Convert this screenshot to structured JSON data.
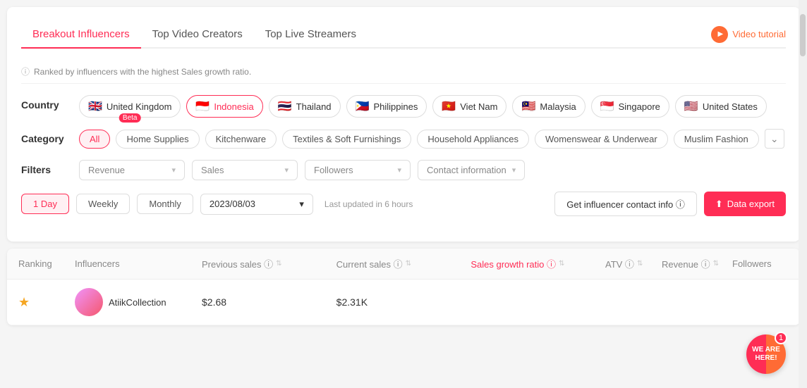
{
  "tabs": [
    {
      "id": "breakout",
      "label": "Breakout Influencers",
      "active": true
    },
    {
      "id": "video",
      "label": "Top Video Creators",
      "active": false
    },
    {
      "id": "live",
      "label": "Top Live Streamers",
      "active": false
    }
  ],
  "video_tutorial": {
    "label": "Video tutorial"
  },
  "info_bar": {
    "text": "Ranked by influencers with the highest Sales growth ratio."
  },
  "country": {
    "label": "Country",
    "options": [
      {
        "id": "uk",
        "flag": "🇬🇧",
        "label": "United Kingdom",
        "selected": false,
        "beta": true
      },
      {
        "id": "indonesia",
        "flag": "🇮🇩",
        "label": "Indonesia",
        "selected": true
      },
      {
        "id": "thailand",
        "flag": "🇹🇭",
        "label": "Thailand",
        "selected": false
      },
      {
        "id": "philippines",
        "flag": "🇵🇭",
        "label": "Philippines",
        "selected": false
      },
      {
        "id": "vietnam",
        "flag": "🇻🇳",
        "label": "Viet Nam",
        "selected": false
      },
      {
        "id": "malaysia",
        "flag": "🇲🇾",
        "label": "Malaysia",
        "selected": false
      },
      {
        "id": "singapore",
        "flag": "🇸🇬",
        "label": "Singapore",
        "selected": false
      },
      {
        "id": "us",
        "flag": "🇺🇸",
        "label": "United States",
        "selected": false
      }
    ]
  },
  "category": {
    "label": "Category",
    "options": [
      {
        "id": "all",
        "label": "All",
        "active": true
      },
      {
        "id": "home",
        "label": "Home Supplies",
        "active": false
      },
      {
        "id": "kitchen",
        "label": "Kitchenware",
        "active": false
      },
      {
        "id": "textiles",
        "label": "Textiles & Soft Furnishings",
        "active": false
      },
      {
        "id": "household",
        "label": "Household Appliances",
        "active": false
      },
      {
        "id": "womens",
        "label": "Womenswear & Underwear",
        "active": false
      },
      {
        "id": "muslim",
        "label": "Muslim Fashion",
        "active": false
      }
    ]
  },
  "filters": {
    "label": "Filters",
    "selects": [
      {
        "id": "revenue",
        "placeholder": "Revenue"
      },
      {
        "id": "sales",
        "placeholder": "Sales"
      },
      {
        "id": "followers",
        "placeholder": "Followers"
      },
      {
        "id": "contact",
        "placeholder": "Contact information"
      }
    ]
  },
  "time": {
    "periods": [
      {
        "id": "1day",
        "label": "1 Day",
        "active": true
      },
      {
        "id": "weekly",
        "label": "Weekly",
        "active": false
      },
      {
        "id": "monthly",
        "label": "Monthly",
        "active": false
      }
    ],
    "date": "2023/08/03",
    "update_info": "Last updated in 6 hours"
  },
  "actions": {
    "contact_btn": "Get influencer contact info ⓘ",
    "export_btn": "Data export"
  },
  "table": {
    "columns": [
      {
        "id": "ranking",
        "label": "Ranking"
      },
      {
        "id": "influencers",
        "label": "Influencers"
      },
      {
        "id": "prev_sales",
        "label": "Previous sales ⓘ"
      },
      {
        "id": "curr_sales",
        "label": "Current sales ⓘ"
      },
      {
        "id": "growth",
        "label": "Sales growth ratio ⓘ",
        "highlight": true
      },
      {
        "id": "atv",
        "label": "ATV ⓘ"
      },
      {
        "id": "revenue",
        "label": "Revenue ⓘ"
      },
      {
        "id": "followers",
        "label": "Followers"
      }
    ],
    "rows": [
      {
        "ranking": "1",
        "name": "AtiikCollection",
        "prev_sales": "$2.68",
        "curr_sales": "$2.31K"
      }
    ]
  },
  "chat": {
    "notification_count": "1"
  }
}
